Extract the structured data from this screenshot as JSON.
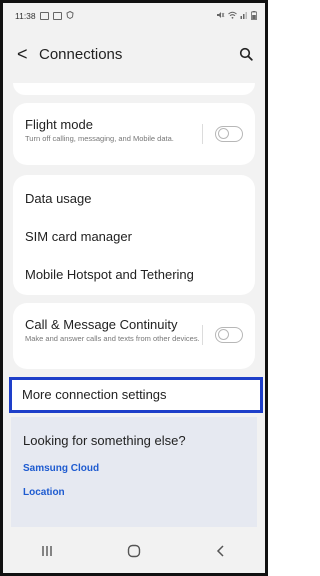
{
  "status_bar": {
    "time": "11:38",
    "left_icons": [
      "image-icon",
      "screenshot-icon",
      "shield-icon"
    ],
    "right_icons": [
      "mute-icon",
      "wifi-icon",
      "signal-icon",
      "battery-icon"
    ]
  },
  "header": {
    "back_glyph": "<",
    "title": "Connections",
    "search_icon": "search-icon"
  },
  "flight_mode": {
    "title": "Flight mode",
    "subtitle": "Turn off calling, messaging, and Mobile data.",
    "toggle_state": "off"
  },
  "menu": {
    "items": [
      "Data usage",
      "SIM card manager",
      "Mobile Hotspot and Tethering"
    ]
  },
  "continuity": {
    "title": "Call & Message Continuity",
    "subtitle": "Make and answer calls and texts from other devices.",
    "toggle_state": "off"
  },
  "more_settings": {
    "label": "More connection settings"
  },
  "looking": {
    "title": "Looking for something else?",
    "links": [
      "Samsung Cloud",
      "Location"
    ]
  },
  "navbar": {
    "icons": [
      "recents-icon",
      "home-icon",
      "back-icon"
    ]
  },
  "colors": {
    "highlight": "#1e3fc9",
    "link": "#1e5bd0",
    "background": "#f2f2f2"
  }
}
